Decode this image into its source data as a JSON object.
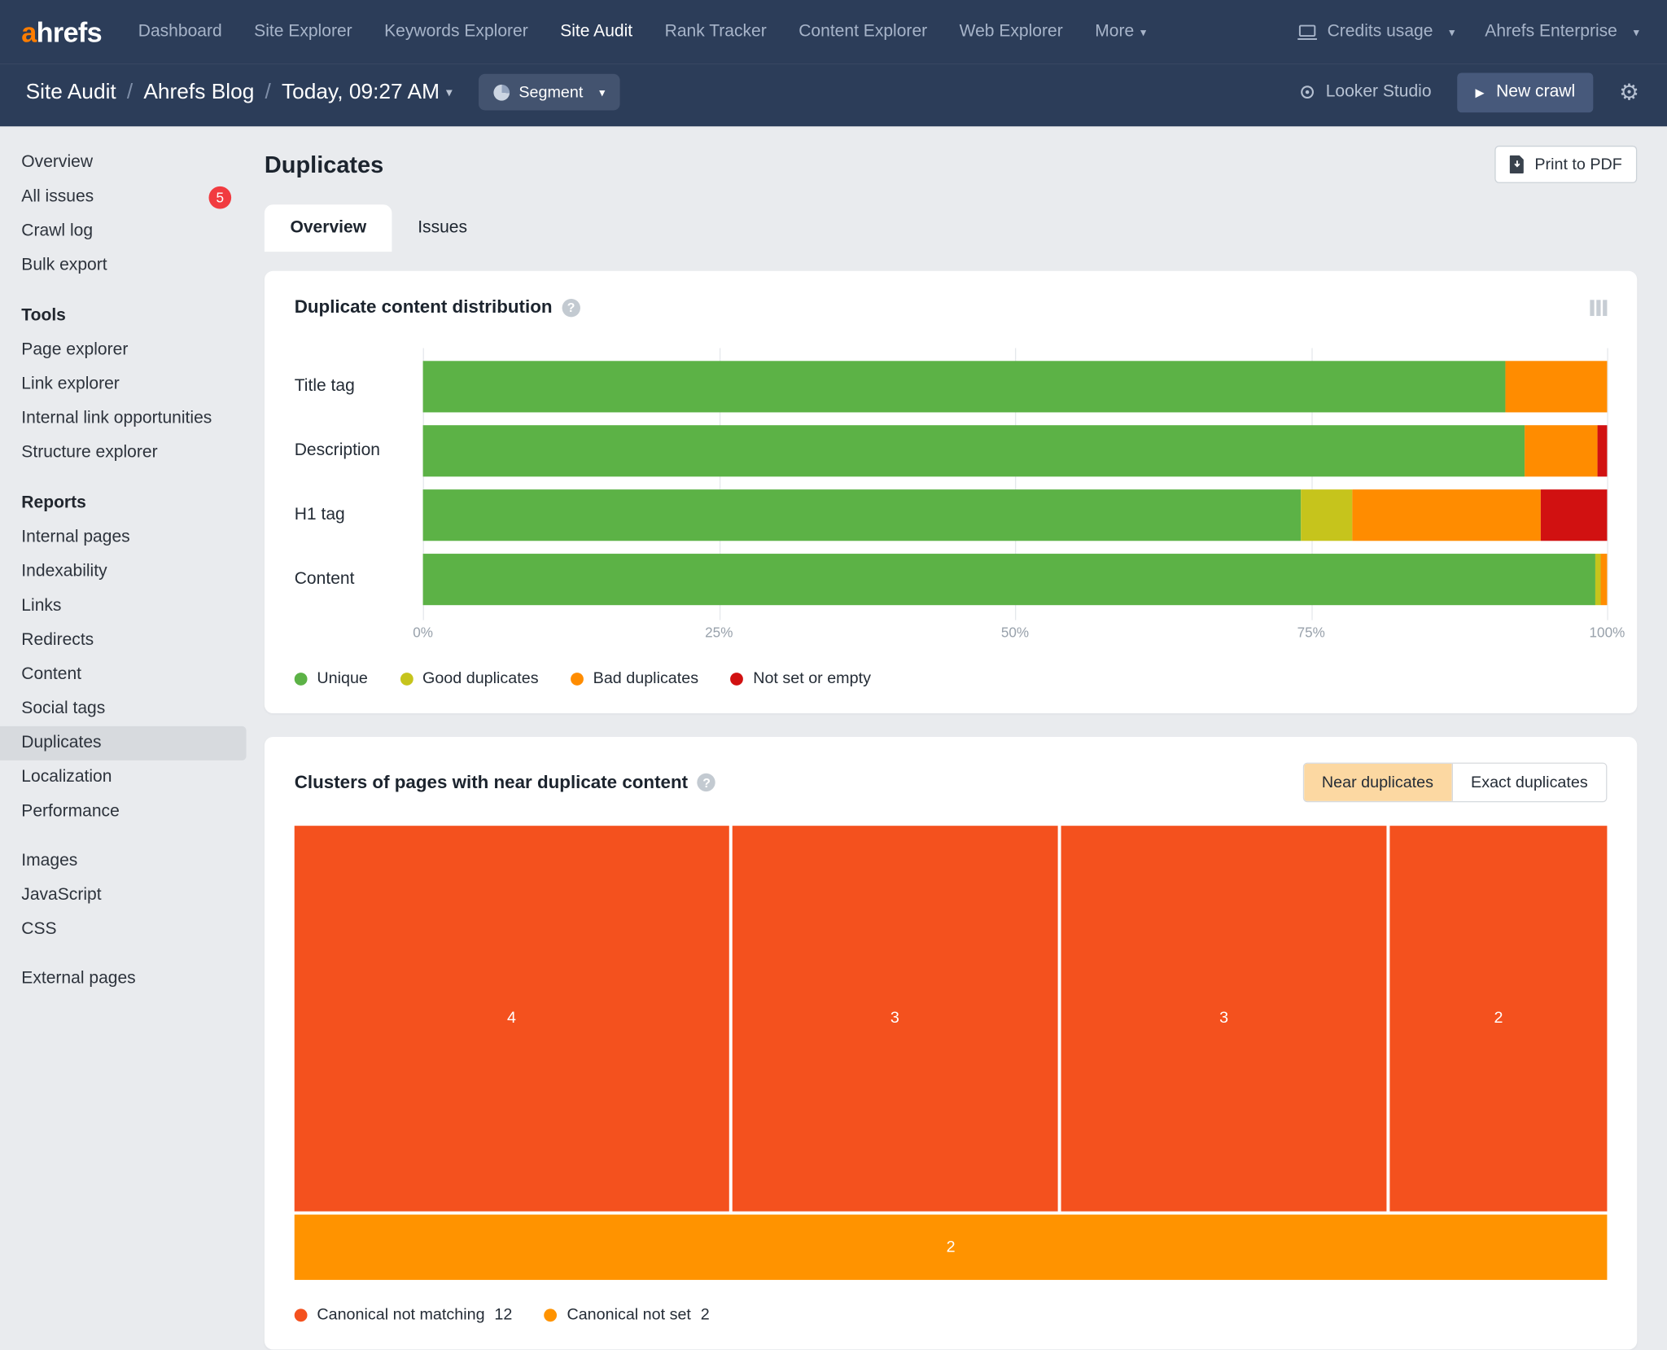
{
  "colors": {
    "accent_orange": "#ff7d00",
    "badge_red": "#f13b40",
    "toggle_active_bg": "#fcd8a2",
    "header_bg": "#2c3d59",
    "sidebar_selected_bg": "#d7dade"
  },
  "nav": {
    "logo_a": "a",
    "logo_rest": "hrefs",
    "items": [
      {
        "label": "Dashboard",
        "active": false
      },
      {
        "label": "Site Explorer",
        "active": false
      },
      {
        "label": "Keywords Explorer",
        "active": false
      },
      {
        "label": "Site Audit",
        "active": true
      },
      {
        "label": "Rank Tracker",
        "active": false
      },
      {
        "label": "Content Explorer",
        "active": false
      },
      {
        "label": "Web Explorer",
        "active": false
      },
      {
        "label": "More",
        "active": false
      }
    ],
    "credits_label": "Credits usage",
    "account_label": "Ahrefs Enterprise"
  },
  "breadcrumb": {
    "section": "Site Audit",
    "separator": "/",
    "project": "Ahrefs Blog",
    "date": "Today, 09:27 AM",
    "segment_label": "Segment",
    "looker_label": "Looker Studio",
    "new_crawl_label": "New crawl"
  },
  "sidebar": {
    "items_top": [
      {
        "label": "Overview"
      },
      {
        "label": "All issues",
        "badge": "5"
      },
      {
        "label": "Crawl log"
      },
      {
        "label": "Bulk export"
      }
    ],
    "tools_title": "Tools",
    "tools_items": [
      "Page explorer",
      "Link explorer",
      "Internal link opportunities",
      "Structure explorer"
    ],
    "reports_title": "Reports",
    "reports_items": [
      "Internal pages",
      "Indexability",
      "Links",
      "Redirects",
      "Content",
      "Social tags",
      "Duplicates",
      "Localization",
      "Performance"
    ],
    "selected_item": "Duplicates",
    "assets_items": [
      "Images",
      "JavaScript",
      "CSS"
    ],
    "external_label": "External pages"
  },
  "page": {
    "title": "Duplicates",
    "print_label": "Print to PDF",
    "tabs": [
      {
        "label": "Overview",
        "active": true
      },
      {
        "label": "Issues",
        "active": false
      }
    ]
  },
  "chart_data": [
    {
      "type": "bar",
      "orientation": "horizontal",
      "stacked": true,
      "title": "Duplicate content distribution",
      "categories": [
        "Title tag",
        "Description",
        "H1 tag",
        "Content"
      ],
      "series": [
        {
          "name": "Unique",
          "color": "#5cb246",
          "values": [
            91.4,
            93.0,
            74.1,
            99.0
          ]
        },
        {
          "name": "Good duplicates",
          "color": "#c6c41c",
          "values": [
            0,
            0,
            4.4,
            0.5
          ]
        },
        {
          "name": "Bad duplicates",
          "color": "#ff8c00",
          "values": [
            8.6,
            6.2,
            15.9,
            0.5
          ]
        },
        {
          "name": "Not set or empty",
          "color": "#d11111",
          "values": [
            0,
            0.8,
            5.6,
            0
          ]
        }
      ],
      "x_ticks": [
        "0%",
        "25%",
        "50%",
        "75%",
        "100%"
      ],
      "xlim": [
        0,
        100
      ],
      "grid": true,
      "legend_position": "bottom"
    },
    {
      "type": "treemap",
      "title": "Clusters of pages with near duplicate content",
      "toggle": [
        {
          "label": "Near duplicates",
          "active": true
        },
        {
          "label": "Exact duplicates",
          "active": false
        }
      ],
      "rows": [
        {
          "height_fraction": 0.855,
          "blocks": [
            {
              "value": 4,
              "color": "#f4511e"
            },
            {
              "value": 3,
              "color": "#f4511e"
            },
            {
              "value": 3,
              "color": "#f4511e"
            },
            {
              "value": 2,
              "color": "#f4511e"
            }
          ]
        },
        {
          "height_fraction": 0.145,
          "blocks": [
            {
              "value": 2,
              "color": "#ff9300"
            }
          ]
        }
      ],
      "legend": [
        {
          "label": "Canonical not matching",
          "value": "12",
          "color": "#f4511e"
        },
        {
          "label": "Canonical not set",
          "value": "2",
          "color": "#ff9300"
        }
      ]
    }
  ]
}
